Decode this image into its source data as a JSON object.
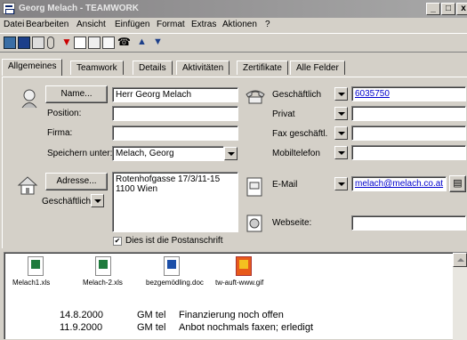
{
  "window": {
    "title": "Georg Melach - TEAMWORK",
    "min": "_",
    "max": "□",
    "close": "x"
  },
  "menu": [
    "Datei",
    "Bearbeiten",
    "Ansicht",
    "Einfügen",
    "Format",
    "Extras",
    "Aktionen",
    "?"
  ],
  "tabs": [
    "Allgemeines",
    "Teamwork",
    "Details",
    "Aktivitäten",
    "Zertifikate",
    "Alle Felder"
  ],
  "contact": {
    "name_button": "Name...",
    "name_value": "Herr Georg Melach",
    "position_label": "Position:",
    "position_value": "",
    "firma_label": "Firma:",
    "firma_value": "",
    "save_as_label": "Speichern unter:",
    "save_as_value": "Melach, Georg",
    "address_button": "Adresse...",
    "address_type": "Geschäftlich",
    "address_line1": "Rotenhofgasse 17/3/11-15",
    "address_line2": "1100  Wien",
    "postal_checkbox_label": "Dies ist die Postanschrift",
    "postal_checkbox_checked": "✔"
  },
  "phones": [
    {
      "label": "Geschäftlich",
      "value": "6035750"
    },
    {
      "label": "Privat",
      "value": ""
    },
    {
      "label": "Fax geschäftl.",
      "value": ""
    },
    {
      "label": "Mobiltelefon",
      "value": ""
    }
  ],
  "email": {
    "label": "E-Mail",
    "value": "melach@melach.co.at"
  },
  "website": {
    "label": "Webseite:",
    "value": ""
  },
  "attachments": [
    "Melach1.xls",
    "Melach-2.xls",
    "bezgemödling.doc",
    "tw-auft-www.gif"
  ],
  "notes": [
    {
      "date": "14.8.2000",
      "type": "GM tel",
      "text": "Finanzierung noch offen"
    },
    {
      "date": "11.9.2000",
      "type": "GM tel",
      "text": "Anbot nochmals faxen; erledigt"
    }
  ]
}
